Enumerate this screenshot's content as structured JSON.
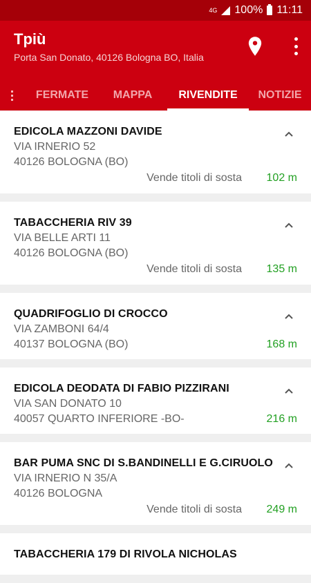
{
  "status": {
    "network": "4G",
    "battery": "100%",
    "time": "11:11"
  },
  "header": {
    "title": "Tpiù",
    "subtitle": "Porta San Donato, 40126 Bologna BO, Italia"
  },
  "tabs": [
    {
      "label": "FERMATE",
      "active": false
    },
    {
      "label": "MAPPA",
      "active": false
    },
    {
      "label": "RIVENDITE",
      "active": true
    },
    {
      "label": "NOTIZIE",
      "active": false
    }
  ],
  "shops": [
    {
      "name": "EDICOLA MAZZONI DAVIDE",
      "address": "VIA IRNERIO 52",
      "city": "40126 BOLOGNA (BO)",
      "note": "Vende titoli di sosta",
      "distance": "102 m"
    },
    {
      "name": "TABACCHERIA RIV 39",
      "address": "VIA BELLE ARTI 11",
      "city": "40126 BOLOGNA (BO)",
      "note": "Vende titoli di sosta",
      "distance": "135 m"
    },
    {
      "name": "QUADRIFOGLIO DI CROCCO",
      "address": "VIA ZAMBONI 64/4",
      "city": "40137 BOLOGNA (BO)",
      "distance": "168 m"
    },
    {
      "name": "EDICOLA DEODATA DI FABIO PIZZIRANI",
      "address": "VIA SAN DONATO 10",
      "city": "40057 QUARTO INFERIORE -BO-",
      "distance": "216 m"
    },
    {
      "name": "BAR PUMA SNC DI S.BANDINELLI E G.CIRUOLO",
      "address": "VIA IRNERIO N 35/A",
      "city": "40126 BOLOGNA",
      "note": "Vende titoli di sosta",
      "distance": "249 m"
    },
    {
      "name": "TABACCHERIA 179 DI RIVOLA NICHOLAS"
    }
  ]
}
